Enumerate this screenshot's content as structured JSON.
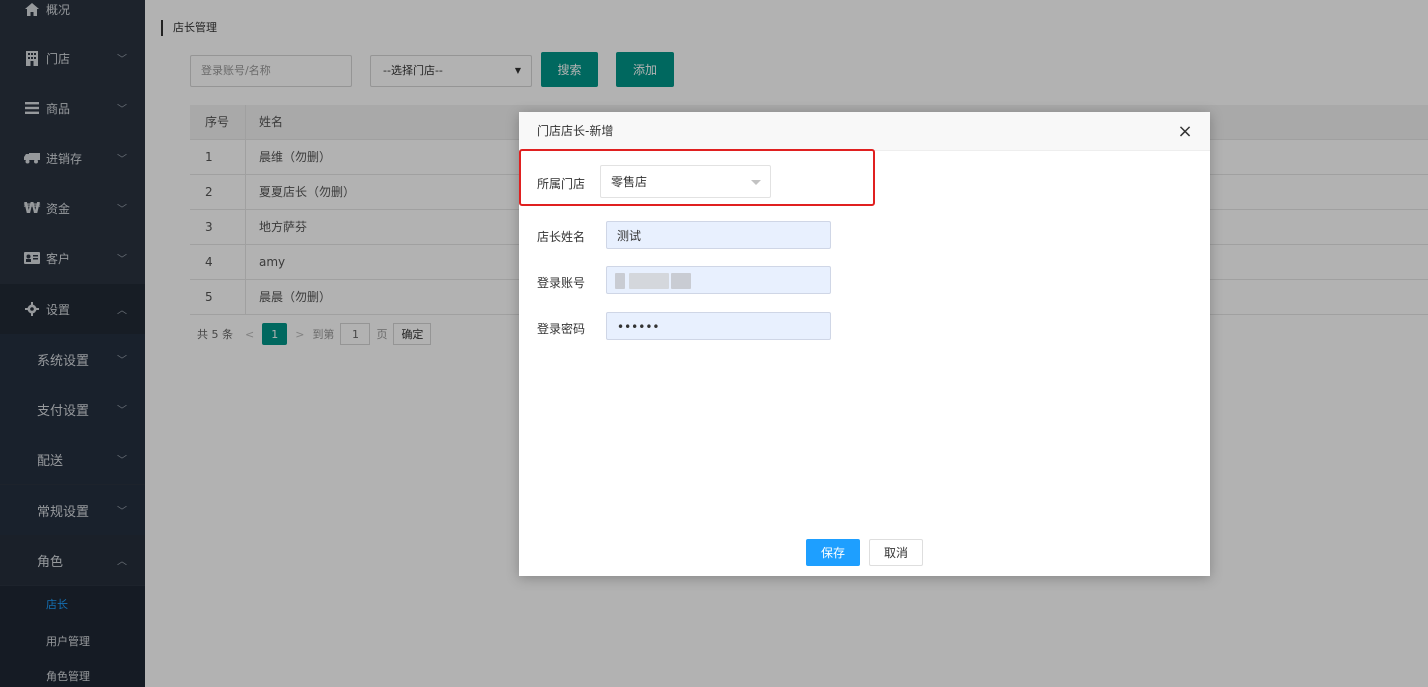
{
  "sidebar": {
    "items": [
      {
        "label": "概况",
        "icon": "home-icon"
      },
      {
        "label": "门店",
        "icon": "building-icon"
      },
      {
        "label": "商品",
        "icon": "list-icon"
      },
      {
        "label": "进销存",
        "icon": "truck-icon"
      },
      {
        "label": "资金",
        "icon": "won-icon"
      },
      {
        "label": "客户",
        "icon": "id-card-icon"
      },
      {
        "label": "设置",
        "icon": "gear-icon"
      }
    ],
    "settings_sub": [
      {
        "label": "系统设置"
      },
      {
        "label": "支付设置"
      },
      {
        "label": "配送"
      },
      {
        "label": "常规设置"
      },
      {
        "label": "角色"
      }
    ],
    "role_leaves": [
      {
        "label": "店长"
      },
      {
        "label": "用户管理"
      },
      {
        "label": "角色管理"
      }
    ]
  },
  "page": {
    "breadcrumb": "店长管理",
    "search_placeholder": "登录账号/名称",
    "store_select": "--选择门店--",
    "search_button": "搜索",
    "add_button": "添加"
  },
  "table": {
    "headers": [
      "序号",
      "姓名"
    ],
    "rows": [
      {
        "no": "1",
        "name": "晨维（勿删）"
      },
      {
        "no": "2",
        "name": "夏夏店长（勿删）"
      },
      {
        "no": "3",
        "name": "地方萨芬"
      },
      {
        "no": "4",
        "name": "amy"
      },
      {
        "no": "5",
        "name": "晨晨（勿删）"
      }
    ]
  },
  "pager": {
    "total": "共 5 条",
    "prev": "<",
    "current": "1",
    "next": ">",
    "goto": "到第",
    "page_input": "1",
    "page_unit": "页",
    "confirm": "确定"
  },
  "modal": {
    "title": "门店店长-新增",
    "close": "×",
    "store_label": "所属门店",
    "store_value": "零售店",
    "name_label": "店长姓名",
    "name_value": "测试",
    "account_label": "登录账号",
    "password_label": "登录密码",
    "password_value": "••••••",
    "save": "保存",
    "cancel": "取消"
  },
  "colors": {
    "sidebar_bg": "#2a3340",
    "primary_teal": "#009688",
    "save_blue": "#1e9fff",
    "highlight_red": "#e02020"
  }
}
